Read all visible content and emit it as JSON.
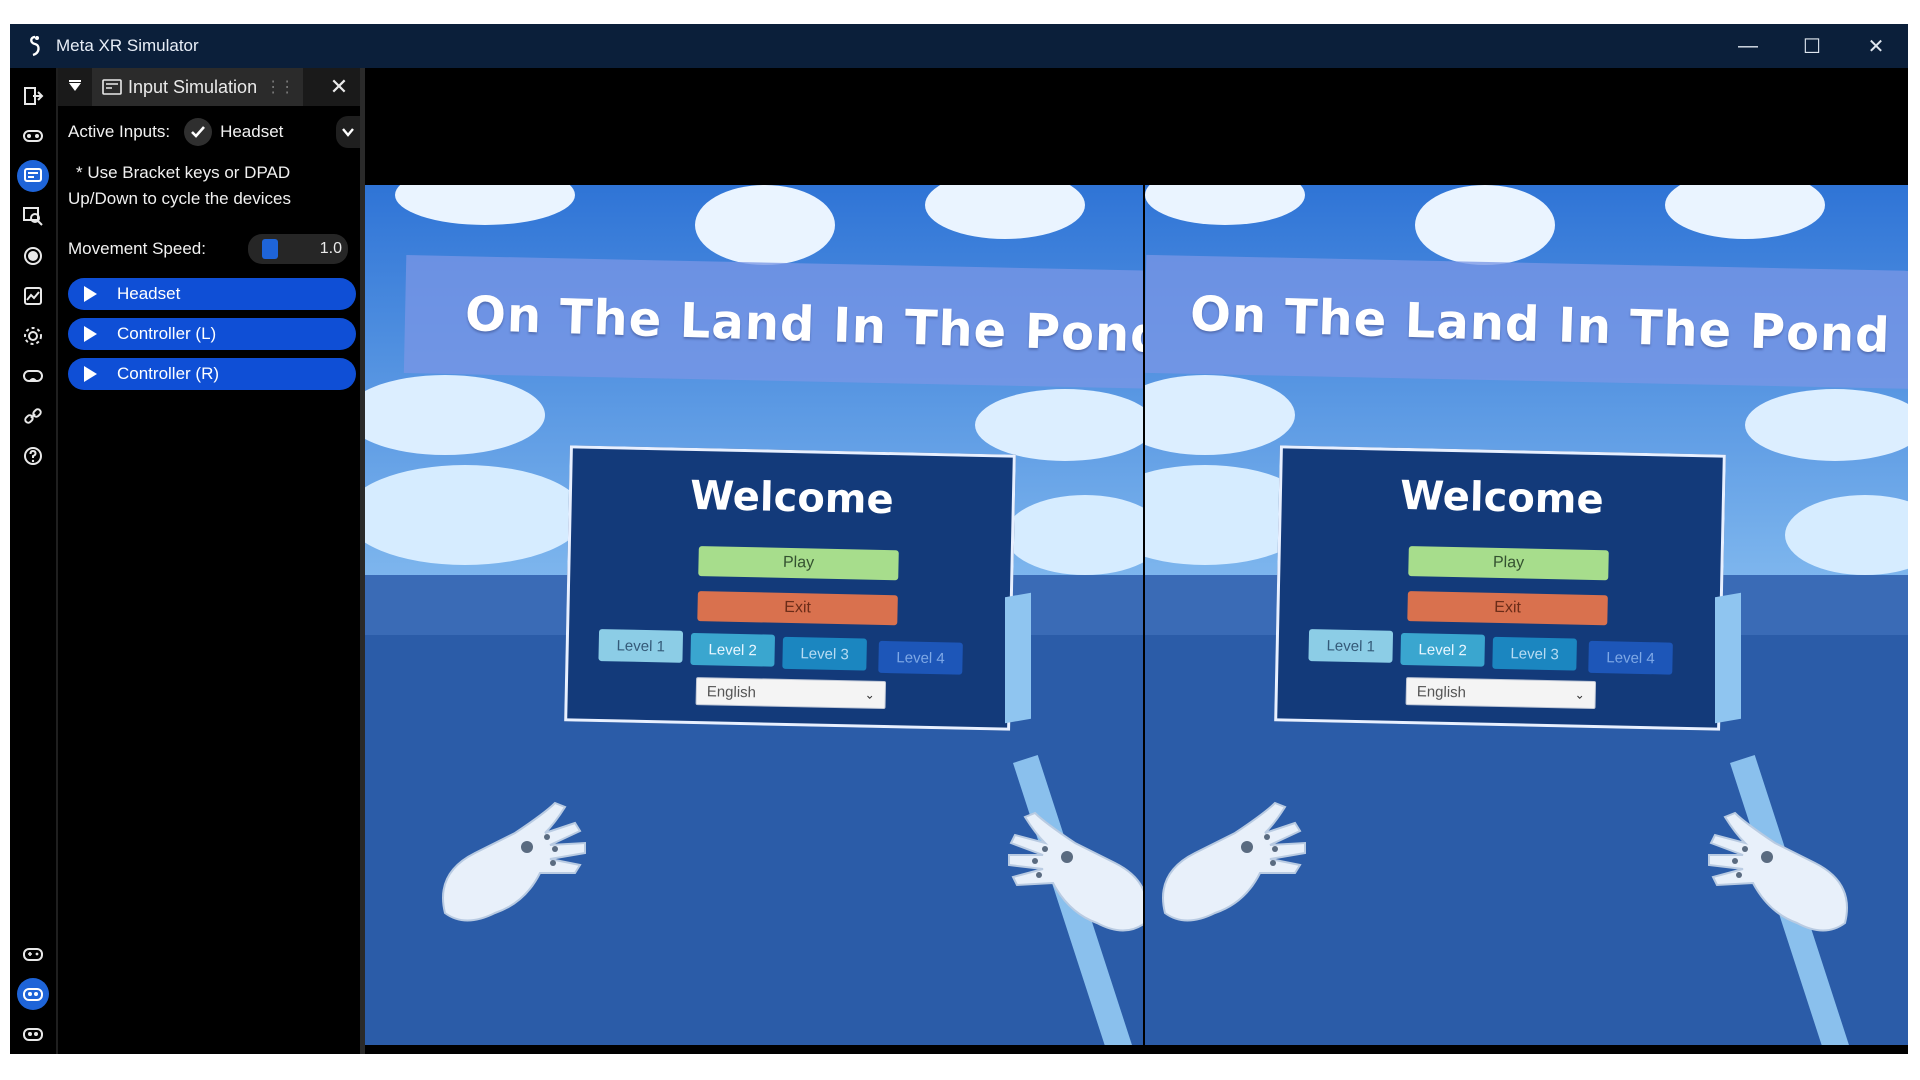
{
  "window": {
    "title": "Meta XR Simulator",
    "minimize": "—",
    "maximize": "☐",
    "close": "✕"
  },
  "rail": {
    "icons": [
      "exit-door-icon",
      "headset-icon",
      "input-simulation-icon",
      "scene-inspector-icon",
      "record-icon",
      "graph-icon",
      "gear-icon",
      "headset-alt-icon",
      "link-icon",
      "help-icon"
    ],
    "bottom_icons": [
      "controller-icon",
      "controller-active-icon",
      "controller-alt-icon"
    ]
  },
  "panel": {
    "tab_label": "Input Simulation",
    "active_inputs_label": "Active Inputs:",
    "active_input_value": "Headset",
    "note_line1": "* Use Bracket keys or DPAD",
    "note_line2": "Up/Down to cycle the devices",
    "movement_speed_label": "Movement Speed:",
    "movement_speed_value": "1.0",
    "sections": [
      "Headset",
      "Controller (L)",
      "Controller (R)"
    ]
  },
  "scene": {
    "game_title": "On The Land In The Pond",
    "menu_heading": "Welcome",
    "play_label": "Play",
    "exit_label": "Exit",
    "levels": [
      "Level 1",
      "Level 2",
      "Level 3",
      "Level 4"
    ],
    "language": "English"
  },
  "colors": {
    "titlebar": "#0b1f3a",
    "accent": "#0f4fd6",
    "sky": "#3e86e0",
    "floor": "#2a5aa6",
    "menu": "#133a7a",
    "play": "#a7dd8c",
    "exit": "#d9714e"
  }
}
